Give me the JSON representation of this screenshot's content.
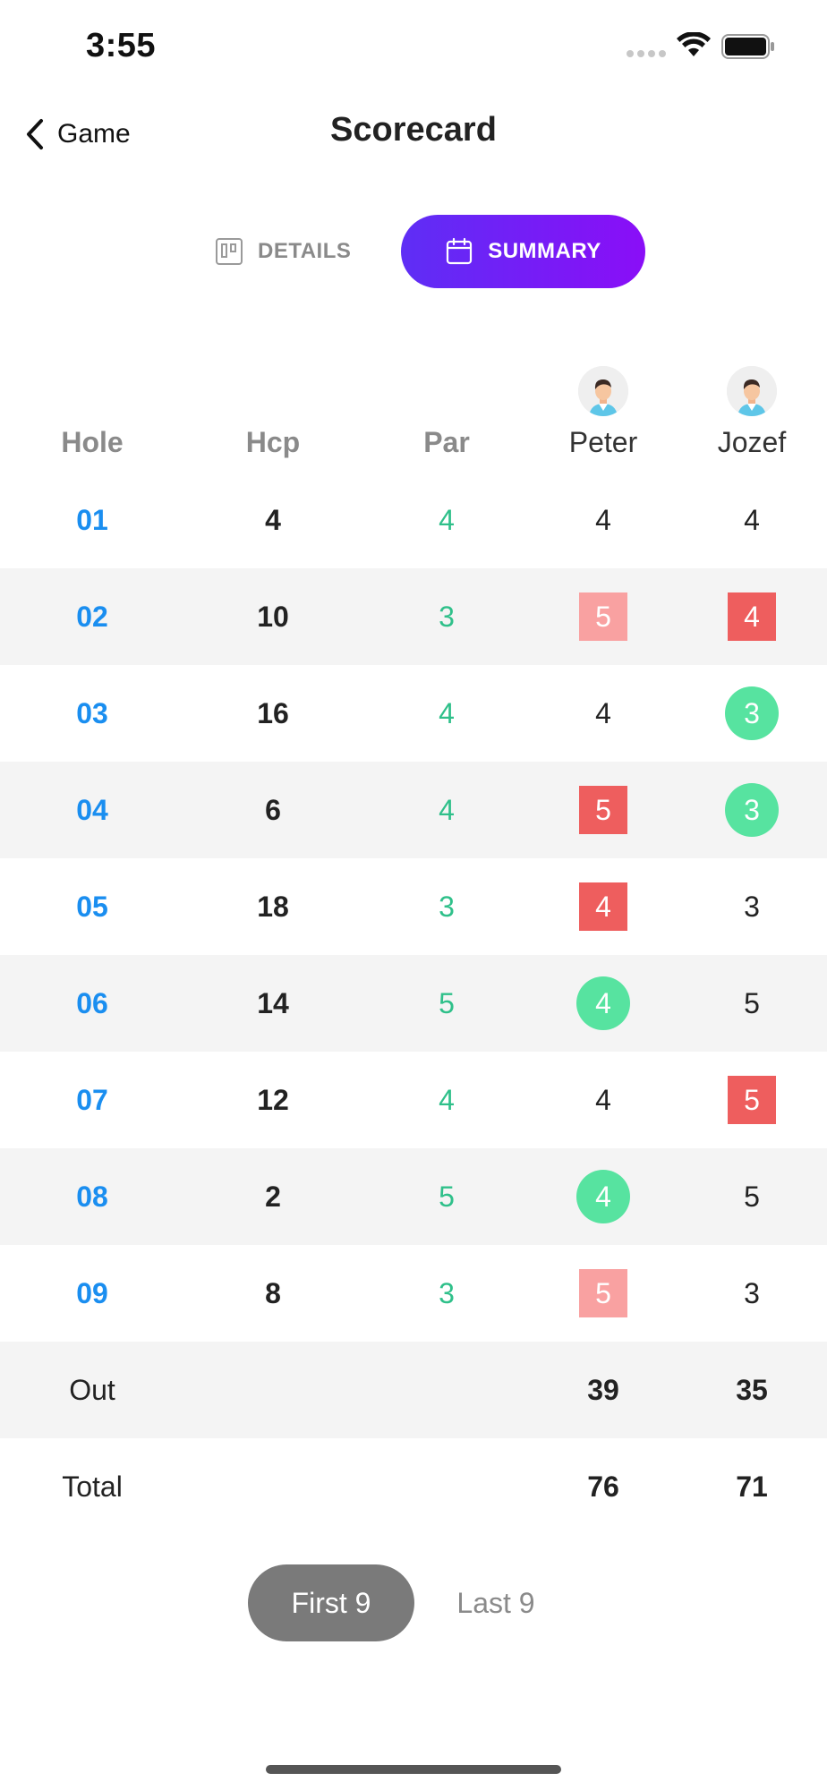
{
  "status_bar": {
    "time": "3:55"
  },
  "nav": {
    "back_label": "Game",
    "title": "Scorecard"
  },
  "tabs": {
    "details": {
      "label": "DETAILS",
      "icon": "board-icon"
    },
    "summary": {
      "label": "SUMMARY",
      "icon": "calendar-icon",
      "selected": true
    }
  },
  "table": {
    "headers": {
      "hole": "Hole",
      "hcp": "Hcp",
      "par": "Par"
    },
    "players": [
      {
        "name": "Peter",
        "avatar": "avatar-icon"
      },
      {
        "name": "Jozef",
        "avatar": "avatar-icon"
      }
    ],
    "rows": [
      {
        "hole": "01",
        "hcp": "4",
        "par": "4",
        "p1": "4",
        "p1_style": "plain",
        "p2": "4",
        "p2_style": "plain"
      },
      {
        "hole": "02",
        "hcp": "10",
        "par": "3",
        "p1": "5",
        "p1_style": "bogey",
        "p2": "4",
        "p2_style": "double"
      },
      {
        "hole": "03",
        "hcp": "16",
        "par": "4",
        "p1": "4",
        "p1_style": "plain",
        "p2": "3",
        "p2_style": "birdie"
      },
      {
        "hole": "04",
        "hcp": "6",
        "par": "4",
        "p1": "5",
        "p1_style": "double",
        "p2": "3",
        "p2_style": "birdie"
      },
      {
        "hole": "05",
        "hcp": "18",
        "par": "3",
        "p1": "4",
        "p1_style": "double",
        "p2": "3",
        "p2_style": "plain"
      },
      {
        "hole": "06",
        "hcp": "14",
        "par": "5",
        "p1": "4",
        "p1_style": "birdie",
        "p2": "5",
        "p2_style": "plain"
      },
      {
        "hole": "07",
        "hcp": "12",
        "par": "4",
        "p1": "4",
        "p1_style": "plain",
        "p2": "5",
        "p2_style": "double"
      },
      {
        "hole": "08",
        "hcp": "2",
        "par": "5",
        "p1": "4",
        "p1_style": "birdie",
        "p2": "5",
        "p2_style": "plain"
      },
      {
        "hole": "09",
        "hcp": "8",
        "par": "3",
        "p1": "5",
        "p1_style": "bogey",
        "p2": "3",
        "p2_style": "plain"
      }
    ],
    "out": {
      "label": "Out",
      "p1": "39",
      "p2": "35"
    },
    "total": {
      "label": "Total",
      "p1": "76",
      "p2": "71"
    }
  },
  "nine_toggle": {
    "first": "First 9",
    "last": "Last 9",
    "selected": "first"
  },
  "colors": {
    "hole_blue": "#1a8ef0",
    "par_green": "#2fc08a",
    "birdie_green": "#57e3a0",
    "double_red": "#ee5e5e",
    "bogey_pink": "#f9a1a1",
    "accent_purple": "#7a1ef6"
  }
}
